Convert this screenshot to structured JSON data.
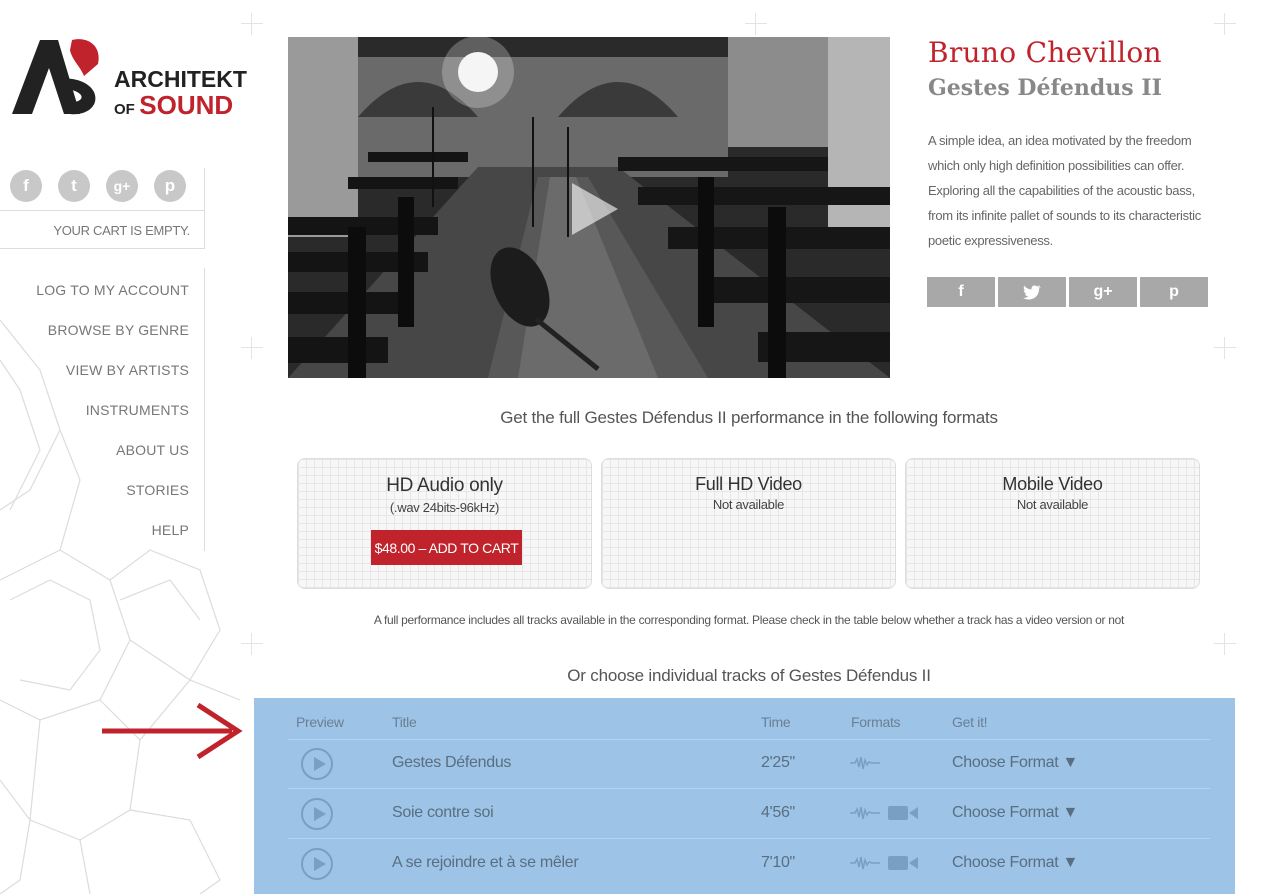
{
  "brand": {
    "line1": "ARCHITEKT",
    "line2_small": "OF",
    "line2_big": "SOUND",
    "accent": "#c0232b"
  },
  "social_left": [
    {
      "icon": "facebook-icon",
      "glyph": "f"
    },
    {
      "icon": "twitter-icon",
      "glyph": "t"
    },
    {
      "icon": "google-plus-icon",
      "glyph": "g+"
    },
    {
      "icon": "pinterest-icon",
      "glyph": "p"
    }
  ],
  "cart": {
    "text": "YOUR CART IS EMPTY."
  },
  "nav": [
    {
      "label": "LOG TO MY ACCOUNT"
    },
    {
      "label": "BROWSE BY GENRE"
    },
    {
      "label": "VIEW BY ARTISTS"
    },
    {
      "label": "INSTRUMENTS"
    },
    {
      "label": "ABOUT US"
    },
    {
      "label": "STORIES"
    },
    {
      "label": "HELP"
    }
  ],
  "artist": {
    "name": "Bruno Chevillon",
    "album": "Gestes Défendus II",
    "description": "A simple idea, an idea motivated by the freedom which only high definition possibilities can offer. Exploring all the capabilities of the acoustic bass, from its infinite pallet of sounds to its characteristic poetic expressiveness."
  },
  "share": [
    {
      "icon": "facebook-icon",
      "glyph": "f"
    },
    {
      "icon": "twitter-icon",
      "glyph": "🐦"
    },
    {
      "icon": "google-plus-icon",
      "glyph": "g+"
    },
    {
      "icon": "pinterest-icon",
      "glyph": "p"
    }
  ],
  "formats": {
    "heading": "Get the full Gestes Défendus II performance in the following formats",
    "items": [
      {
        "title": "HD Audio only",
        "sub": "(.wav 24bits-96kHz)",
        "button": "$48.00 – ADD TO CART"
      },
      {
        "title": "Full HD Video",
        "sub": "Not available"
      },
      {
        "title": "Mobile Video",
        "sub": "Not available"
      }
    ],
    "note": "A full performance includes all tracks available in the corresponding format. Please check in the table below whether a track has a video version or not"
  },
  "tracks": {
    "heading": "Or choose individual tracks of Gestes Défendus II",
    "columns": [
      "Preview",
      "Title",
      "Time",
      "Formats",
      "Get it!"
    ],
    "rows": [
      {
        "title": "Gestes Défendus",
        "time": "2'25\"",
        "video": false,
        "get": "Choose Format ▼"
      },
      {
        "title": "Soie contre soi",
        "time": "4'56\"",
        "video": true,
        "get": "Choose Format ▼"
      },
      {
        "title": "A se rejoindre et à se mêler",
        "time": "7'10\"",
        "video": true,
        "get": "Choose Format ▼"
      }
    ]
  }
}
